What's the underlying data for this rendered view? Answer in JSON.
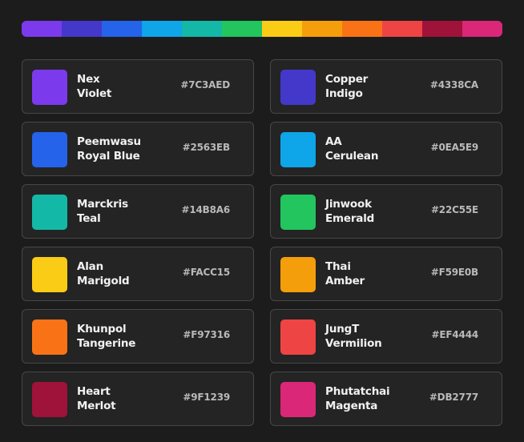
{
  "palette": [
    {
      "person": "Nex",
      "color_name": "Violet",
      "hex": "#7C3AED",
      "color": "#7C3AED"
    },
    {
      "person": "Copper",
      "color_name": "Indigo",
      "hex": "#4338CA",
      "color": "#4338CA"
    },
    {
      "person": "Peemwasu",
      "color_name": "Royal Blue",
      "hex": "#2563EB",
      "color": "#2563EB"
    },
    {
      "person": "AA",
      "color_name": "Cerulean",
      "hex": "#0EA5E9",
      "color": "#0EA5E9"
    },
    {
      "person": "Marckris",
      "color_name": "Teal",
      "hex": "#14B8A6",
      "color": "#14B8A6"
    },
    {
      "person": "Jinwook",
      "color_name": "Emerald",
      "hex": "#22C55E",
      "color": "#22C55E"
    },
    {
      "person": "Alan",
      "color_name": "Marigold",
      "hex": "#FACC15",
      "color": "#FACC15"
    },
    {
      "person": "Thai",
      "color_name": "Amber",
      "hex": "#F59E0B",
      "color": "#F59E0B"
    },
    {
      "person": "Khunpol",
      "color_name": "Tangerine",
      "hex": "#F97316",
      "color": "#F97316"
    },
    {
      "person": "JungT",
      "color_name": "Vermilion",
      "hex": "#EF4444",
      "color": "#EF4444"
    },
    {
      "person": "Heart",
      "color_name": "Merlot",
      "hex": "#9F1239",
      "color": "#9F1239"
    },
    {
      "person": "Phutatchai",
      "color_name": "Magenta",
      "hex": "#DB2777",
      "color": "#DB2777"
    }
  ],
  "strip_colors": [
    "#7C3AED",
    "#4338CA",
    "#2563EB",
    "#0EA5E9",
    "#14B8A6",
    "#22C55E",
    "#FACC15",
    "#F59E0B",
    "#F97316",
    "#EF4444",
    "#9F1239",
    "#DB2777"
  ]
}
